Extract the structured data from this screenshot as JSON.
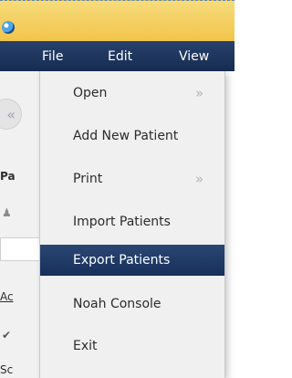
{
  "menubar": {
    "items": [
      "File",
      "Edit",
      "View"
    ]
  },
  "left_panel": {
    "back_glyph": "«",
    "cut_text": [
      "Pa",
      "Ac",
      "Sc"
    ]
  },
  "file_menu": {
    "items": [
      {
        "label": "Open",
        "submenu_glyph": "»"
      },
      {
        "label": "Add New Patient"
      },
      {
        "label": "Print",
        "submenu_glyph": "»"
      },
      {
        "label": "Import Patients"
      },
      {
        "label": "Export Patients",
        "highlighted": true
      },
      {
        "label": "Noah Console"
      },
      {
        "label": "Exit"
      }
    ]
  },
  "colors": {
    "titlebar": "#f1c44a",
    "menubar": "#1e355e",
    "highlight": "#1f3a66"
  }
}
